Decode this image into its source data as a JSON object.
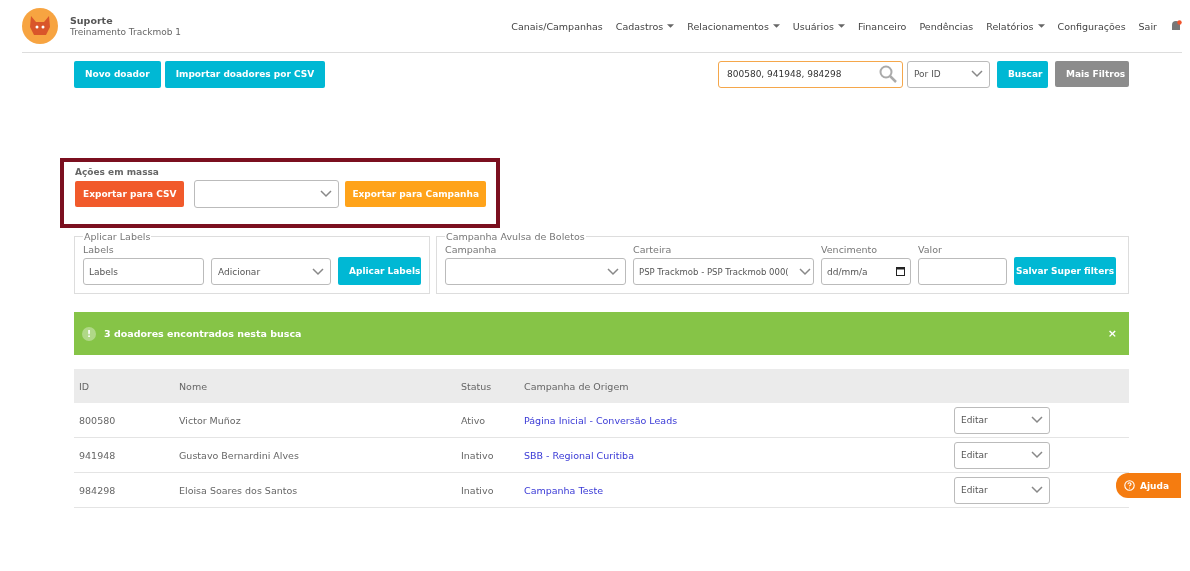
{
  "header": {
    "title": "Suporte",
    "subtitle": "Treinamento Trackmob 1",
    "nav": [
      {
        "label": "Canais/Campanhas",
        "dropdown": false
      },
      {
        "label": "Cadastros",
        "dropdown": true
      },
      {
        "label": "Relacionamentos",
        "dropdown": true
      },
      {
        "label": "Usuários",
        "dropdown": true
      },
      {
        "label": "Financeiro",
        "dropdown": false
      },
      {
        "label": "Pendências",
        "dropdown": false
      },
      {
        "label": "Relatórios",
        "dropdown": true
      },
      {
        "label": "Configurações",
        "dropdown": false
      },
      {
        "label": "Sair",
        "dropdown": false
      }
    ]
  },
  "toolbar": {
    "buttons": [
      "Novo doador",
      "Importar doadores por CSV"
    ],
    "search_value": "800580, 941948, 984298",
    "search_by": "Por ID",
    "search_button": "Buscar",
    "more_filters_button": "Mais Filtros"
  },
  "bulk_actions": {
    "title": "Ações em massa",
    "export_csv": "Exportar para CSV",
    "export_campaign": "Exportar para Campanha"
  },
  "apply_labels": {
    "legend": "Aplicar Labels",
    "label": "Labels",
    "placeholder": "Labels",
    "action": "Adicionar",
    "button": "Aplicar Labels"
  },
  "boleto_campaign": {
    "legend": "Campanha Avulsa de Boletos",
    "campaign_label": "Campanha",
    "wallet_label": "Carteira",
    "wallet_value": "PSP Trackmob - PSP Trackmob 000(",
    "due_label": "Vencimento",
    "due_placeholder": "dd/mm/a",
    "value_label": "Valor",
    "button": "Salvar Super filters"
  },
  "alert": {
    "icon": "!",
    "message": "3 doadores encontrados nesta busca",
    "close": "×"
  },
  "table": {
    "columns": [
      "ID",
      "Nome",
      "Status",
      "Campanha de Origem"
    ],
    "rows": [
      {
        "id": "800580",
        "name": "Victor Muñoz",
        "status": "Ativo",
        "campaign": "Página Inicial - Conversão Leads",
        "action": "Editar"
      },
      {
        "id": "941948",
        "name": "Gustavo Bernardini Alves",
        "status": "Inativo",
        "campaign": "SBB - Regional Curitiba",
        "action": "Editar"
      },
      {
        "id": "984298",
        "name": "Eloisa Soares dos Santos",
        "status": "Inativo",
        "campaign": "Campanha Teste",
        "action": "Editar"
      }
    ]
  },
  "help_button": "Ajuda"
}
